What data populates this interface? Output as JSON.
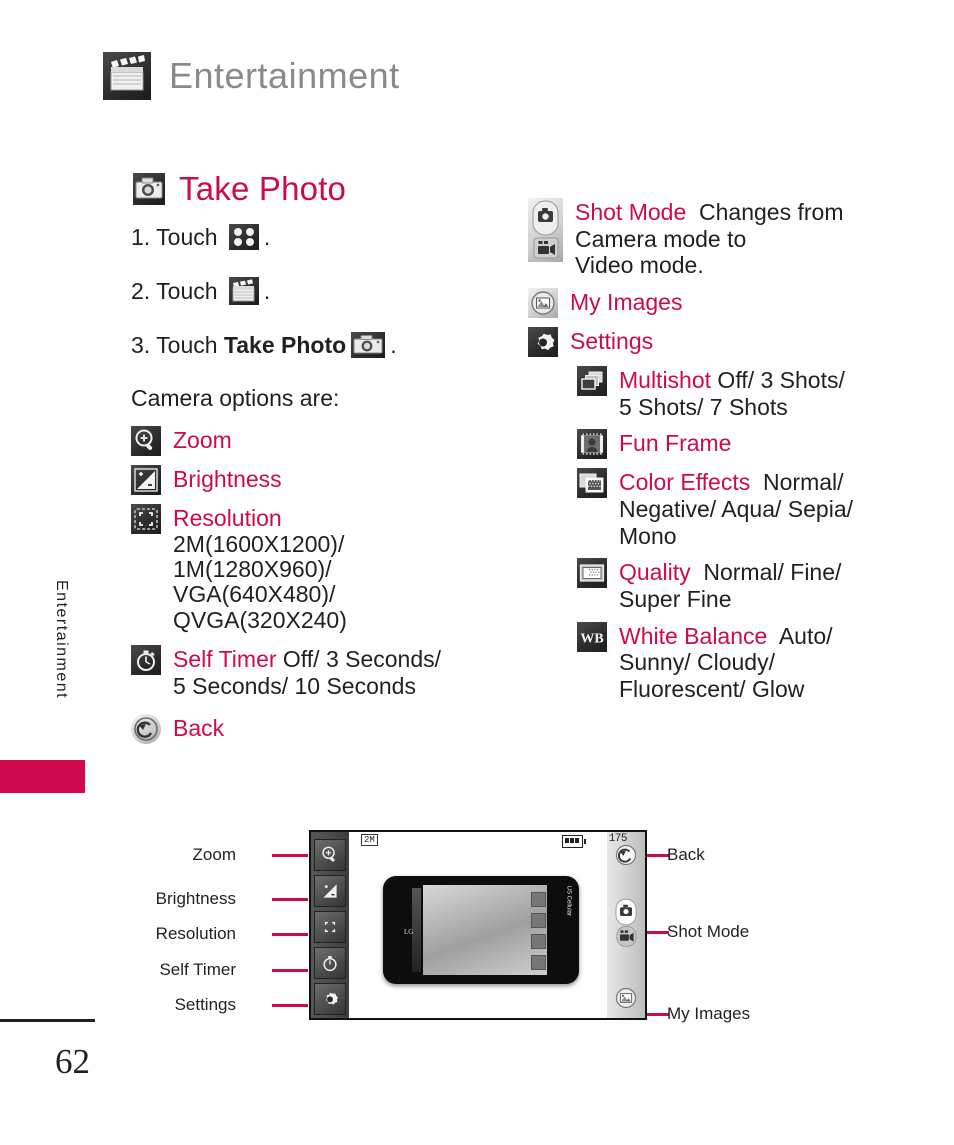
{
  "header": {
    "title": "Entertainment",
    "icon": "clapperboard-icon"
  },
  "side_tab": {
    "label": "Entertainment"
  },
  "page": {
    "number": "62"
  },
  "page_title": {
    "text": "Take Photo",
    "icon": "camera-icon"
  },
  "steps": [
    {
      "num": "1. Touch ",
      "bold": "",
      "after": ".",
      "icon": "grid-four-dots-icon"
    },
    {
      "num": "2. Touch ",
      "bold": "",
      "after": ".",
      "icon": "clapperboard-icon"
    },
    {
      "num": "3. Touch ",
      "bold": "Take Photo",
      "after": ".",
      "icon": "camera-icon"
    }
  ],
  "lead_in": "Camera options are:",
  "left_options": [
    {
      "name": "Zoom",
      "values": "",
      "icon": "zoom-magnifier-icon"
    },
    {
      "name": "Brightness",
      "values": "",
      "icon": "brightness-icon"
    },
    {
      "name": "Resolution",
      "values": "2M(1600X1200)/ 1M(1280X960)/ VGA(640X480)/ QVGA(320X240)",
      "icon": "resolution-icon"
    },
    {
      "name": "Self Timer",
      "values": " Off/ 3 Seconds/ 5 Seconds/ 10 Seconds",
      "icon": "self-timer-icon"
    },
    {
      "name": "Back",
      "values": "",
      "icon": "back-arrow-icon"
    }
  ],
  "right_options": [
    {
      "name": "Shot Mode",
      "values": " Changes from Camera mode to Video mode.",
      "icon": "shot-mode-icon"
    },
    {
      "name": "My Images",
      "values": "",
      "icon": "my-images-icon"
    },
    {
      "name": "Settings",
      "values": "",
      "icon": "gear-icon"
    }
  ],
  "settings_sub_options": [
    {
      "name": "Multishot",
      "values": " Off/ 3 Shots/ 5 Shots/ 7 Shots",
      "icon": "multishot-icon"
    },
    {
      "name": "Fun Frame",
      "values": "",
      "icon": "fun-frame-icon"
    },
    {
      "name": "Color Effects",
      "values": " Normal/ Negative/ Aqua/ Sepia/ Mono",
      "icon": "color-effects-icon"
    },
    {
      "name": "Quality",
      "values": " Normal/ Fine/ Super Fine",
      "icon": "quality-icon"
    },
    {
      "name": "White Balance",
      "values": " Auto/ Sunny/ Cloudy/ Fluorescent/ Glow",
      "icon": "white-balance-icon"
    }
  ],
  "diagram": {
    "status_bar": {
      "mode_badge": "2M",
      "counter": "175",
      "battery": "battery-icon"
    },
    "left_labels": [
      "Zoom",
      "Brightness",
      "Resolution",
      "Self Timer",
      "Settings"
    ],
    "right_labels": [
      "Back",
      "Shot Mode",
      "My Images"
    ],
    "phone_brand": "US Cellular",
    "phone_logo": "LG"
  },
  "colors": {
    "accent": "#CE0A4E",
    "header_gray": "#8A8A8A",
    "text": "#231F20"
  }
}
